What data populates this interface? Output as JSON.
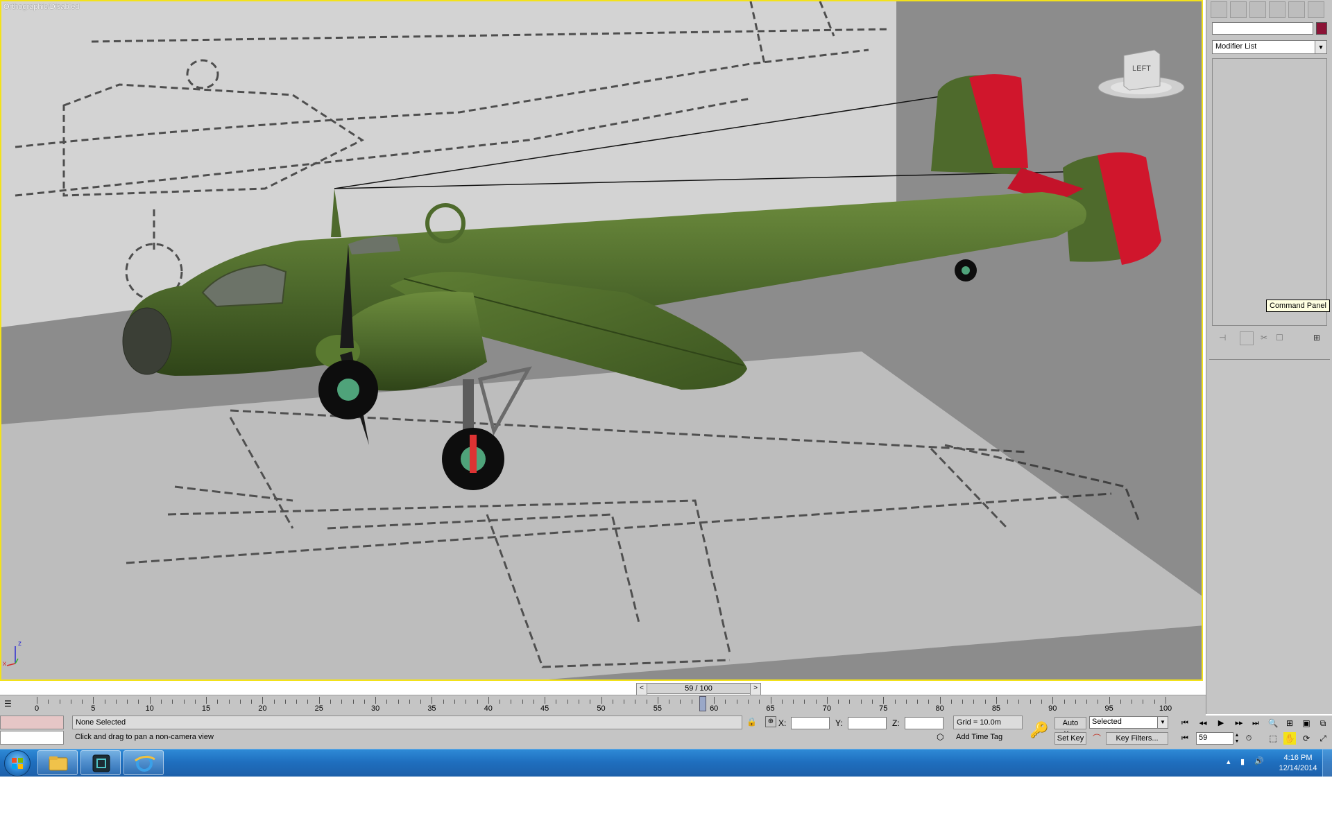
{
  "viewport": {
    "label": "Orthographic/Disabled",
    "viewcube_label": "LEFT",
    "axis_labels": {
      "z": "z",
      "x": "x"
    }
  },
  "tooltip": "Command Panel",
  "command_panel": {
    "tabs": [
      "create-icon",
      "modify-icon",
      "hierarchy-icon",
      "motion-icon",
      "display-icon",
      "utilities-icon"
    ],
    "modifier_list": "Modifier List",
    "object_color": "#8c1437"
  },
  "timeline": {
    "slider": "59 / 100",
    "prev": "<",
    "next": ">",
    "current_frame": 59,
    "tick_labels": [
      "0",
      "5",
      "10",
      "15",
      "20",
      "25",
      "30",
      "35",
      "40",
      "45",
      "50",
      "55",
      "60",
      "65",
      "70",
      "75",
      "80",
      "85",
      "90",
      "95",
      "100"
    ]
  },
  "status": {
    "selection": "None Selected",
    "prompt": "Click and drag to pan a non-camera view",
    "x_label": "X:",
    "y_label": "Y:",
    "z_label": "Z:",
    "grid": "Grid = 10.0m",
    "add_time_tag": "Add Time Tag",
    "auto_key": "Auto Key",
    "set_key": "Set Key",
    "key_mode": "Selected",
    "key_filters": "Key Filters...",
    "frame": "59"
  },
  "taskbar": {
    "time": "4:16 PM",
    "date": "12/14/2014",
    "pinned": [
      "windows-explorer-icon",
      "3ds-max-icon",
      "internet-explorer-icon"
    ]
  },
  "colors": {
    "fuselage": "#4e6a2c",
    "tail_tip": "#d0162c",
    "viewport_bg": "#8c8c8c",
    "active_border": "#f3e21a"
  }
}
